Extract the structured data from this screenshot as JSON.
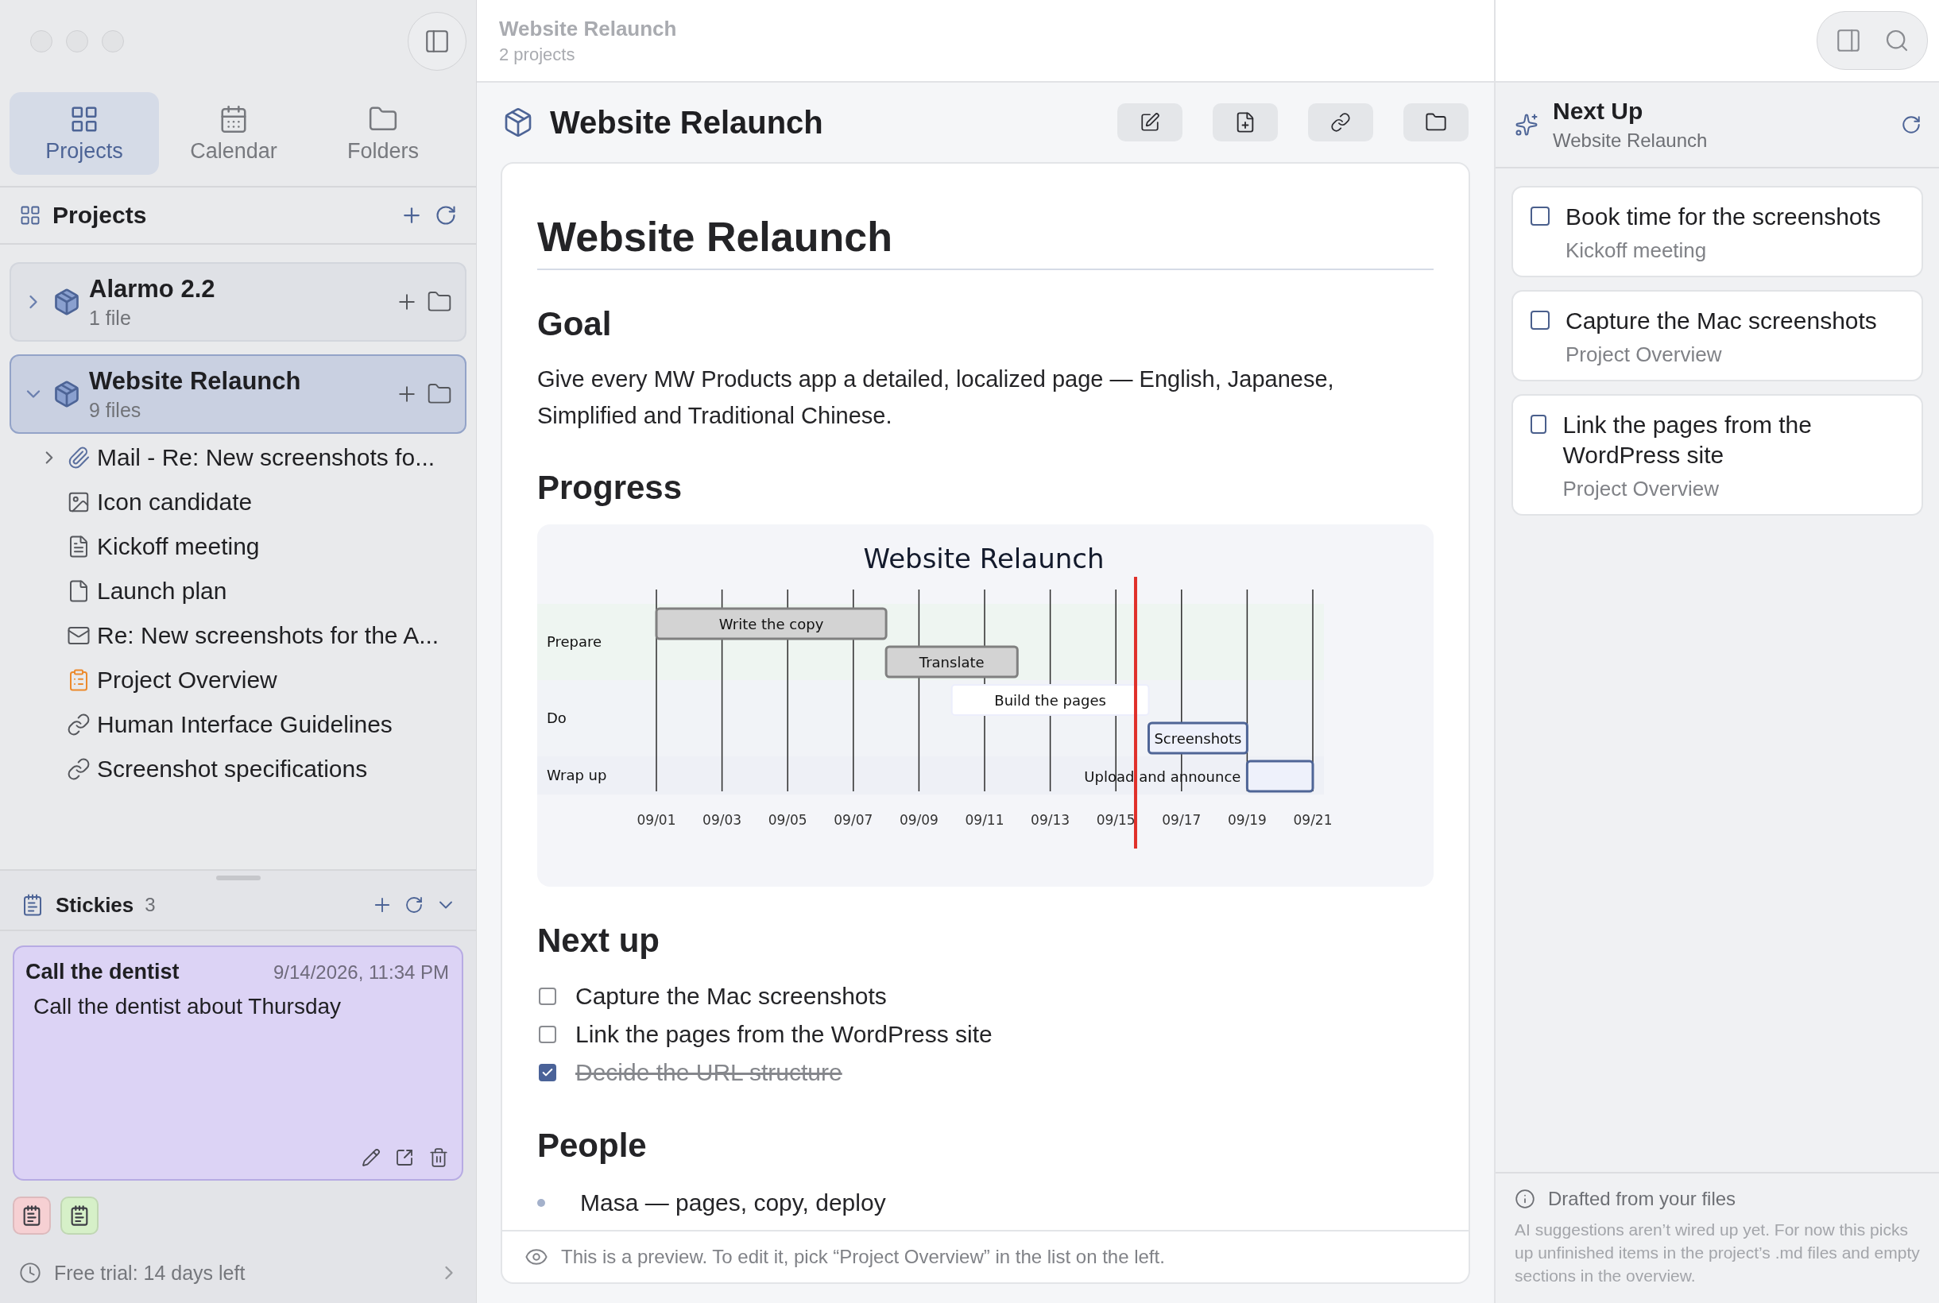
{
  "sidebar": {
    "tabs": [
      {
        "label": "Projects",
        "selected": true
      },
      {
        "label": "Calendar",
        "selected": false
      },
      {
        "label": "Folders",
        "selected": false
      }
    ],
    "projects_header": {
      "title": "Projects"
    },
    "projects": [
      {
        "name": "Alarmo 2.2",
        "count": "1 file",
        "selected": false,
        "expanded": false
      },
      {
        "name": "Website Relaunch",
        "count": "9 files",
        "selected": true,
        "expanded": true,
        "children": [
          {
            "kind": "attachment",
            "label": "Mail - Re: New screenshots fo...",
            "expanded": false
          },
          {
            "kind": "image",
            "label": "Icon candidate"
          },
          {
            "kind": "note",
            "label": "Kickoff meeting"
          },
          {
            "kind": "file",
            "label": "Launch plan"
          },
          {
            "kind": "mail",
            "label": "Re: New screenshots for the A..."
          },
          {
            "kind": "overview",
            "label": "Project Overview"
          },
          {
            "kind": "link",
            "label": "Human Interface Guidelines"
          },
          {
            "kind": "link",
            "label": "Screenshot specifications"
          }
        ]
      }
    ],
    "stickies": {
      "title": "Stickies",
      "count": "3",
      "expanded": true,
      "items": [
        {
          "title": "Call the dentist",
          "date": "9/14/2026, 11:34 PM",
          "body": "Call the dentist about Thursday",
          "color": "#dcd3f5",
          "expanded": true
        },
        {
          "color": "#f6d0d3",
          "expanded": false
        },
        {
          "color": "#d6f0c8",
          "expanded": false
        }
      ]
    },
    "footer": {
      "text": "Free trial: 14 days left"
    }
  },
  "main": {
    "top_bar": {
      "title": "Website Relaunch",
      "subtitle": "2 projects"
    },
    "header": {
      "title": "Website Relaunch"
    },
    "document": {
      "title": "Website Relaunch",
      "goal": {
        "heading": "Goal",
        "text": "Give every MW Products app a detailed, localized page — English, Japanese, Simplified and Traditional Chinese."
      },
      "progress": {
        "heading": "Progress",
        "gantt": {
          "title": "Website Relaunch",
          "sections": [
            {
              "name": "Prepare",
              "tasks": [
                {
                  "label": "Write the copy",
                  "kind": "done"
                },
                {
                  "label": "Translate",
                  "kind": "done"
                }
              ]
            },
            {
              "name": "Do",
              "tasks": [
                {
                  "label": "Build the pages",
                  "kind": "active"
                },
                {
                  "label": "Screenshots",
                  "kind": "planned"
                }
              ]
            },
            {
              "name": "Wrap up",
              "tasks": [
                {
                  "label": "Upload and announce",
                  "kind": "planned"
                }
              ]
            }
          ],
          "ticks": [
            "09/01",
            "09/03",
            "09/05",
            "09/07",
            "09/09",
            "09/11",
            "09/13",
            "09/15",
            "09/17",
            "09/19",
            "09/21"
          ]
        }
      },
      "next_up": {
        "heading": "Next up",
        "items": [
          {
            "text": "Capture the Mac screenshots",
            "checked": false
          },
          {
            "text": "Link the pages from the WordPress site",
            "checked": false
          },
          {
            "text": "Decide the URL structure",
            "checked": true
          }
        ]
      },
      "people": {
        "heading": "People",
        "items": [
          "Masa — pages, copy, deploy"
        ]
      }
    },
    "preview_note": "This is a preview. To edit it, pick “Project Overview” in the list on the left."
  },
  "next_up_panel": {
    "title": "Next Up",
    "subtitle": "Website Relaunch",
    "items": [
      {
        "title": "Book time for the screenshots",
        "source": "Kickoff meeting",
        "checked": false
      },
      {
        "title": "Capture the Mac screenshots",
        "source": "Project Overview",
        "checked": false
      },
      {
        "title": "Link the pages from the WordPress site",
        "source": "Project Overview",
        "checked": false
      }
    ],
    "footer": {
      "title": "Drafted from your files",
      "text": "AI suggestions aren’t wired up yet. For now this picks up unfinished items in the project’s .md files and empty sections in the overview."
    }
  }
}
